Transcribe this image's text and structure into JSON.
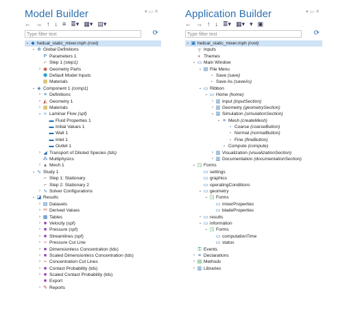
{
  "left": {
    "title": "Model Builder",
    "filter_placeholder": "Type filter text",
    "toolbar": [
      "←",
      "→",
      "↑",
      "↓",
      "≡",
      "≣▾",
      "▦▾",
      "▤▾"
    ],
    "tree": [
      {
        "d": 0,
        "a": "v",
        "i": "◆",
        "c": "#2a6fb0",
        "t": "helical_static_mixer.mph",
        "s": "(root)",
        "sel": true
      },
      {
        "d": 1,
        "a": "v",
        "i": "⊕",
        "c": "#2a6fb0",
        "t": "Global Definitions"
      },
      {
        "d": 2,
        "a": "",
        "i": "P",
        "c": "#2a6fb0",
        "t": "Parameters 1"
      },
      {
        "d": 2,
        "a": "",
        "i": "⌐",
        "c": "#555",
        "t": "Step 1",
        "s": "(step1)"
      },
      {
        "d": 2,
        "a": ">",
        "i": "◉",
        "c": "#c0392b",
        "t": "Geometry Parts"
      },
      {
        "d": 2,
        "a": "",
        "i": "⬢",
        "c": "#2a9fd6",
        "t": "Default Model Inputs"
      },
      {
        "d": 2,
        "a": "",
        "i": "▦",
        "c": "#c9a227",
        "t": "Materials"
      },
      {
        "d": 1,
        "a": "v",
        "i": "◈",
        "c": "#2a6fb0",
        "t": "Component 1",
        "s": "(comp1)"
      },
      {
        "d": 2,
        "a": ">",
        "i": "≡",
        "c": "#2a6fb0",
        "t": "Definitions"
      },
      {
        "d": 2,
        "a": ">",
        "i": "◭",
        "c": "#c0392b",
        "t": "Geometry 1"
      },
      {
        "d": 2,
        "a": ">",
        "i": "▦",
        "c": "#c9a227",
        "t": "Materials"
      },
      {
        "d": 2,
        "a": "v",
        "i": "≈",
        "c": "#2a6fb0",
        "t": "Laminar Flow",
        "s": "(spf)"
      },
      {
        "d": 3,
        "a": "",
        "i": "▬",
        "c": "#2a6fb0",
        "t": "Fluid Properties 1"
      },
      {
        "d": 3,
        "a": "",
        "i": "▬",
        "c": "#2a6fb0",
        "t": "Initial Values 1"
      },
      {
        "d": 3,
        "a": "",
        "i": "▬",
        "c": "#2a6fb0",
        "t": "Wall 1"
      },
      {
        "d": 3,
        "a": "",
        "i": "▬",
        "c": "#2a6fb0",
        "t": "Inlet 1"
      },
      {
        "d": 3,
        "a": "",
        "i": "▬",
        "c": "#2a6fb0",
        "t": "Outlet 1"
      },
      {
        "d": 2,
        "a": ">",
        "i": "◢",
        "c": "#2a6fb0",
        "t": "Transport of Diluted Species",
        "s": "(tds)"
      },
      {
        "d": 2,
        "a": "",
        "i": "⁂",
        "c": "#2a6fb0",
        "t": "Multiphysics"
      },
      {
        "d": 2,
        "a": ">",
        "i": "▲",
        "c": "#777",
        "t": "Mesh 1"
      },
      {
        "d": 1,
        "a": "v",
        "i": "∿",
        "c": "#2a6fb0",
        "t": "Study 1"
      },
      {
        "d": 2,
        "a": "",
        "i": "⌐",
        "c": "#555",
        "t": "Step 1: Stationary"
      },
      {
        "d": 2,
        "a": "",
        "i": "⌐",
        "c": "#555",
        "t": "Step 2: Stationary 2"
      },
      {
        "d": 2,
        "a": ">",
        "i": "∿",
        "c": "#2a6fb0",
        "t": "Solver Configurations"
      },
      {
        "d": 1,
        "a": "v",
        "i": "◪",
        "c": "#2a6fb0",
        "t": "Results"
      },
      {
        "d": 2,
        "a": ">",
        "i": "▤",
        "c": "#2a6fb0",
        "t": "Datasets"
      },
      {
        "d": 2,
        "a": ">",
        "i": "⁸⁸",
        "c": "#c0392b",
        "t": "Derived Values"
      },
      {
        "d": 2,
        "a": ">",
        "i": "▦",
        "c": "#2a6fb0",
        "t": "Tables"
      },
      {
        "d": 2,
        "a": ">",
        "i": "■",
        "c": "#8e44ad",
        "t": "Velocity",
        "s": "(spf)",
        "plain": true
      },
      {
        "d": 2,
        "a": ">",
        "i": "■",
        "c": "#8e44ad",
        "t": "Pressure",
        "s": "(spf)",
        "plain": true
      },
      {
        "d": 2,
        "a": ">",
        "i": "■",
        "c": "#8e44ad",
        "t": "Streamlines",
        "s": "(spf)",
        "plain": true
      },
      {
        "d": 2,
        "a": ">",
        "i": "∼",
        "c": "#c0392b",
        "t": "Pressure Cut Line"
      },
      {
        "d": 2,
        "a": ">",
        "i": "■",
        "c": "#8e44ad",
        "t": "Dimensionless Concentration",
        "s": "(tds)",
        "plain": true
      },
      {
        "d": 2,
        "a": ">",
        "i": "■",
        "c": "#8e44ad",
        "t": "Scaled Dimensionless Concentration",
        "s": "(tds)",
        "plain": true
      },
      {
        "d": 2,
        "a": ">",
        "i": "∼",
        "c": "#c0392b",
        "t": "Concentration Cut Lines"
      },
      {
        "d": 2,
        "a": ">",
        "i": "■",
        "c": "#8e44ad",
        "t": "Contact Probability",
        "s": "(tds)",
        "plain": true
      },
      {
        "d": 2,
        "a": ">",
        "i": "■",
        "c": "#8e44ad",
        "t": "Scaled Contact Probability",
        "s": "(tds)",
        "plain": true
      },
      {
        "d": 2,
        "a": "",
        "i": "■",
        "c": "#8e44ad",
        "t": "Export"
      },
      {
        "d": 2,
        "a": ">",
        "i": "✎",
        "c": "#c0392b",
        "t": "Reports"
      }
    ]
  },
  "right": {
    "title": "Application Builder",
    "filter_placeholder": "Type filter text",
    "toolbar": [
      "←",
      "→",
      "↑",
      "↓",
      "≣▾",
      "▦▾",
      "▾",
      "▣"
    ],
    "tree": [
      {
        "d": 0,
        "a": "v",
        "i": "▣",
        "c": "#2a6fb0",
        "t": "helical_static_mixer.mph",
        "s": "(root)",
        "sel": true
      },
      {
        "d": 1,
        "a": "",
        "i": "┬",
        "c": "#555",
        "t": "Inputs"
      },
      {
        "d": 1,
        "a": "",
        "i": "◐",
        "c": "#c0392b",
        "t": "Themes"
      },
      {
        "d": 1,
        "a": "v",
        "i": "▭",
        "c": "#2a6fb0",
        "t": "Main Window"
      },
      {
        "d": 2,
        "a": "v",
        "i": "▤",
        "c": "#2a6fb0",
        "t": "File Menu"
      },
      {
        "d": 3,
        "a": "",
        "i": "▫",
        "c": "#2a6fb0",
        "t": "Save",
        "s": "(save)"
      },
      {
        "d": 3,
        "a": "",
        "i": "▫",
        "c": "#2a6fb0",
        "t": "Save As",
        "s": "(saveAs)"
      },
      {
        "d": 2,
        "a": "v",
        "i": "▭",
        "c": "#2a6fb0",
        "t": "Ribbon"
      },
      {
        "d": 3,
        "a": "v",
        "i": "▭",
        "c": "#2a6fb0",
        "t": "Home",
        "s": "(home)"
      },
      {
        "d": 4,
        "a": ">",
        "i": "▥",
        "c": "#2a6fb0",
        "t": "Input",
        "s": "(inputSection)"
      },
      {
        "d": 4,
        "a": ">",
        "i": "▥",
        "c": "#2a6fb0",
        "t": "Geometry",
        "s": "(geometrySection)"
      },
      {
        "d": 4,
        "a": "v",
        "i": "▥",
        "c": "#2a6fb0",
        "t": "Simulation",
        "s": "(simulationSection)"
      },
      {
        "d": 5,
        "a": "v",
        "i": "≡",
        "c": "#2a6fb0",
        "t": "Mesh",
        "s": "(createMesh)"
      },
      {
        "d": 6,
        "a": "",
        "i": "▫",
        "c": "#2a6fb0",
        "t": "Coarse",
        "s": "(coarseButton)"
      },
      {
        "d": 6,
        "a": "",
        "i": "▫",
        "c": "#2a6fb0",
        "t": "Normal",
        "s": "(normalButton)"
      },
      {
        "d": 6,
        "a": "",
        "i": "▫",
        "c": "#2a6fb0",
        "t": "Fine",
        "s": "(fineButton)"
      },
      {
        "d": 5,
        "a": "",
        "i": "▫",
        "c": "#2a6fb0",
        "t": "Compute",
        "s": "(compute)"
      },
      {
        "d": 4,
        "a": ">",
        "i": "▥",
        "c": "#2a6fb0",
        "t": "Visualization",
        "s": "(visualizationSection)"
      },
      {
        "d": 4,
        "a": ">",
        "i": "▥",
        "c": "#2a6fb0",
        "t": "Documentation",
        "s": "(documentationSection)"
      },
      {
        "d": 1,
        "a": "v",
        "i": "◳",
        "c": "#2a9a4a",
        "t": "Forms"
      },
      {
        "d": 2,
        "a": "",
        "i": "▭",
        "c": "#2a6fb0",
        "t": "settings"
      },
      {
        "d": 2,
        "a": "",
        "i": "▭",
        "c": "#2a6fb0",
        "t": "graphics"
      },
      {
        "d": 2,
        "a": "",
        "i": "▭",
        "c": "#2a6fb0",
        "t": "operatingConditions"
      },
      {
        "d": 2,
        "a": "v",
        "i": "▭",
        "c": "#2a6fb0",
        "t": "geometry"
      },
      {
        "d": 3,
        "a": "v",
        "i": "◳",
        "c": "#2a9a4a",
        "t": "Forms"
      },
      {
        "d": 4,
        "a": "",
        "i": "▭",
        "c": "#2a6fb0",
        "t": "mixerProperties"
      },
      {
        "d": 4,
        "a": "",
        "i": "▭",
        "c": "#2a6fb0",
        "t": "bladeProperties"
      },
      {
        "d": 2,
        "a": ">",
        "i": "▭",
        "c": "#2a6fb0",
        "t": "results"
      },
      {
        "d": 2,
        "a": "v",
        "i": "▭",
        "c": "#2a6fb0",
        "t": "information"
      },
      {
        "d": 3,
        "a": "v",
        "i": "◳",
        "c": "#2a9a4a",
        "t": "Forms"
      },
      {
        "d": 4,
        "a": "",
        "i": "▭",
        "c": "#2a6fb0",
        "t": "computationTime"
      },
      {
        "d": 4,
        "a": "",
        "i": "▭",
        "c": "#2a6fb0",
        "t": "status"
      },
      {
        "d": 1,
        "a": "",
        "i": "⚿",
        "c": "#2a9a4a",
        "t": "Events"
      },
      {
        "d": 1,
        "a": ">",
        "i": "≡",
        "c": "#2a6fb0",
        "t": "Declarations"
      },
      {
        "d": 1,
        "a": ">",
        "i": "▤",
        "c": "#2a9a4a",
        "t": "Methods"
      },
      {
        "d": 1,
        "a": ">",
        "i": "▥",
        "c": "#2a6fb0",
        "t": "Libraries"
      }
    ]
  }
}
